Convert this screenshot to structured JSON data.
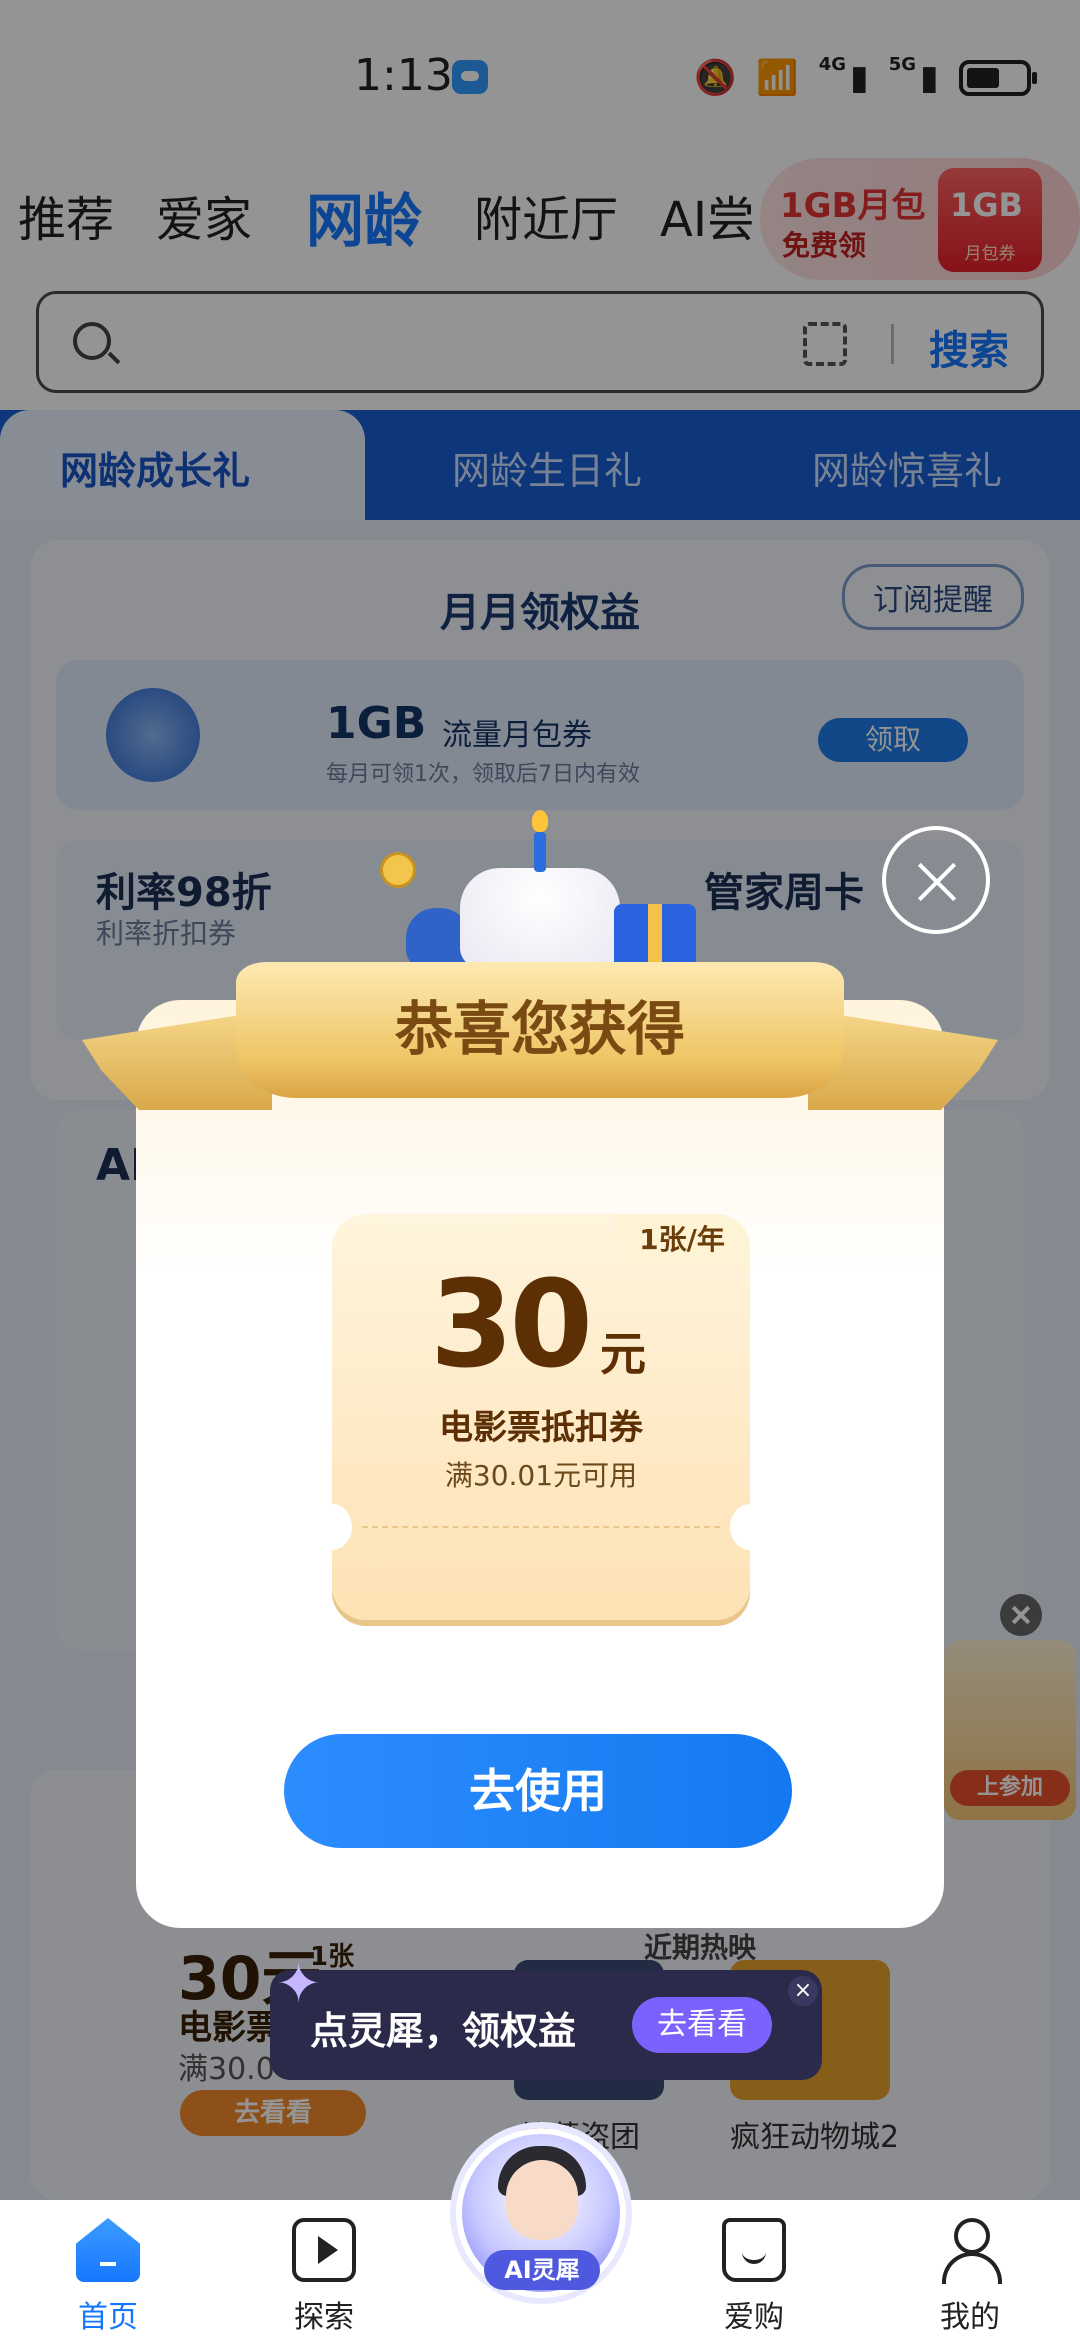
{
  "status_bar": {
    "time": "1:13",
    "net1": "4G",
    "net2": "5G"
  },
  "tabs": [
    {
      "label": "推荐"
    },
    {
      "label": "爱家"
    },
    {
      "label": "网龄"
    },
    {
      "label": "附近厅"
    },
    {
      "label": "AI尝"
    }
  ],
  "promo": {
    "line1": "1GB月包",
    "line2": "免费领",
    "card_big": "1GB",
    "card_small": "月包券"
  },
  "search": {
    "placeholder": "",
    "button": "搜索"
  },
  "background": {
    "seg_tabs": [
      "网龄成长礼",
      "网龄生日礼",
      "网龄惊喜礼"
    ],
    "section_title": "月月领权益",
    "subscribe_btn": "订阅提醒",
    "flow": {
      "title": "1GB",
      "subtitle": "流量月包券",
      "note": "每月可领1次，领取后7日内有效",
      "button": "领取"
    },
    "rate": {
      "title": "利率98折",
      "sub": "利率折扣券",
      "right_title": "管家周卡"
    },
    "ai_title": "AI",
    "movie": {
      "amount": "30元",
      "tag": "1张",
      "name": "电影票",
      "cond": "满30.0",
      "button": "去看看",
      "hot": "近期热映",
      "film1": "坟墓盗团",
      "film2": "疯狂动物城2"
    },
    "side_promo": "上参加"
  },
  "dialog": {
    "ribbon_title": "恭喜您获得",
    "voucher": {
      "tag": "1张/年",
      "amount": "30",
      "unit": "元",
      "name": "电影票抵扣券",
      "condition": "满30.01元可用"
    },
    "use_button": "去使用"
  },
  "ai_banner": {
    "text": "点灵犀，领权益",
    "button": "去看看",
    "close": "×"
  },
  "bottom_nav": [
    {
      "label": "首页",
      "active": true
    },
    {
      "label": "探索"
    },
    {
      "label": "AI灵犀"
    },
    {
      "label": "爱购"
    },
    {
      "label": "我的"
    }
  ],
  "colors": {
    "accent": "#1677ff",
    "mask": "rgba(0,0,0,0.42)",
    "voucher_text": "#5c2f04",
    "ribbon": "#efc667"
  }
}
